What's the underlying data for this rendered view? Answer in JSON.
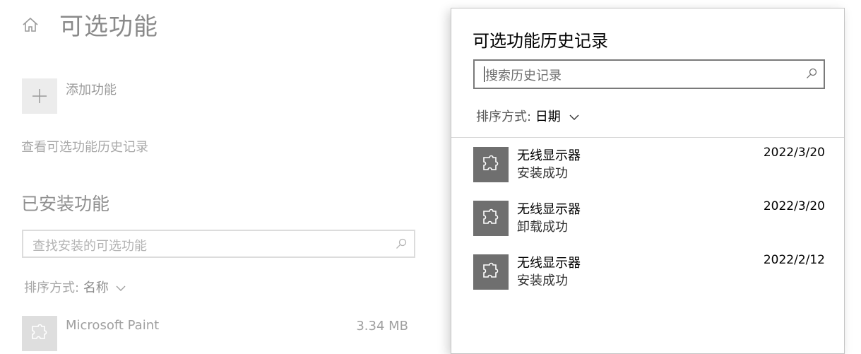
{
  "page": {
    "title": "可选功能",
    "add_feature_label": "添加功能",
    "view_history_link": "查看可选功能历史记录",
    "installed_heading": "已安装功能",
    "installed_search_placeholder": "查找安装的可选功能",
    "sort_label": "排序方式:",
    "sort_value": "名称",
    "installed_features": [
      {
        "name": "Microsoft Paint",
        "size": "3.34 MB",
        "icon": "puzzle-icon"
      }
    ]
  },
  "flyout": {
    "title": "可选功能历史记录",
    "search_placeholder": "搜索历史记录",
    "sort_label": "排序方式:",
    "sort_value": "日期",
    "items": [
      {
        "name": "无线显示器",
        "status": "安装成功",
        "date": "2022/3/20",
        "icon": "puzzle-icon"
      },
      {
        "name": "无线显示器",
        "status": "卸载成功",
        "date": "2022/3/20",
        "icon": "puzzle-icon"
      },
      {
        "name": "无线显示器",
        "status": "安装成功",
        "date": "2022/2/12",
        "icon": "puzzle-icon"
      }
    ]
  },
  "colors": {
    "tile_dark": "#6f6f6f",
    "tile_light": "#dedede",
    "search_border": "#7a7a7a"
  }
}
